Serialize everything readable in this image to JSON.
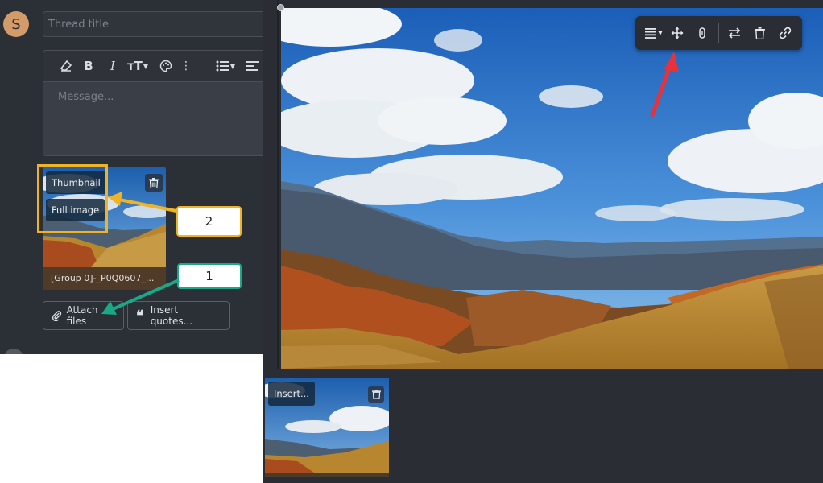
{
  "left_panel": {
    "avatar_letter": "S",
    "thread_title_placeholder": "Thread title",
    "message_placeholder": "Message...",
    "toolbar_icons": [
      "eraser-icon",
      "bold-icon",
      "italic-icon",
      "text-size-icon",
      "palette-icon",
      "more-vertical-icon",
      "list-icon",
      "align-icon"
    ],
    "toolbar_bold": "B",
    "toolbar_italic": "I",
    "toolbar_text_size": "тT",
    "attachment": {
      "overlay_thumbnail": "Thumbnail",
      "overlay_full_image": "Full image",
      "file_name": "[Group 0]-_P0Q0607_..."
    },
    "attach_files_label": "Attach files",
    "insert_quotes_label": "Insert quotes..."
  },
  "annotations": {
    "label_1": "1",
    "label_2": "2",
    "colors": {
      "orange": "#f0b323",
      "green": "#1aa886",
      "red": "#e8323a"
    }
  },
  "right_panel": {
    "image_toolbar_icons": [
      "align-dropdown-icon",
      "move-icon",
      "alt-text-icon",
      "swap-icon",
      "delete-icon",
      "link-icon"
    ],
    "bottom_thumb_insert_label": "Insert..."
  }
}
